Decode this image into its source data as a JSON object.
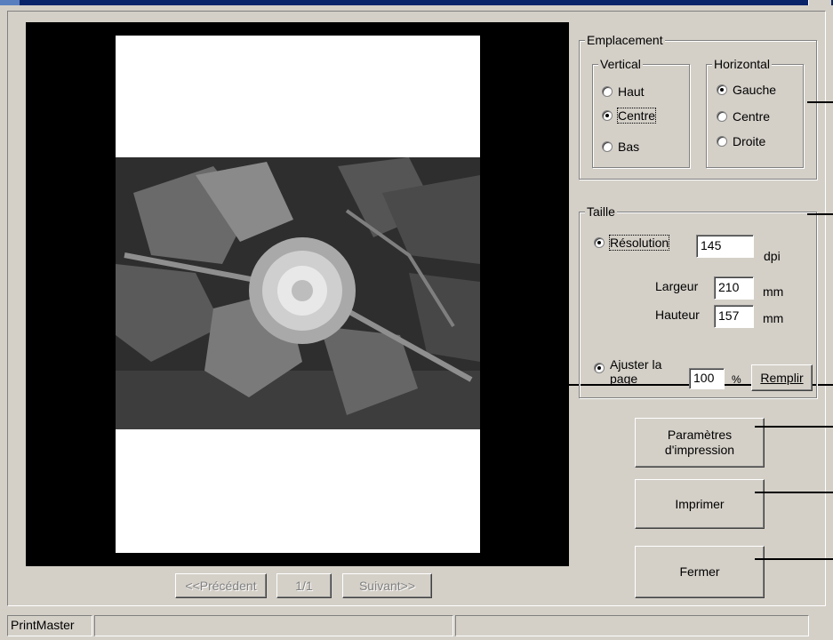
{
  "emplacement": {
    "legend": "Emplacement",
    "vertical": {
      "legend": "Vertical",
      "options": [
        "Haut",
        "Centre",
        "Bas"
      ],
      "selected": "Centre"
    },
    "horizontal": {
      "legend": "Horizontal",
      "options": [
        "Gauche",
        "Centre",
        "Droite"
      ],
      "selected": "Gauche"
    }
  },
  "taille": {
    "legend": "Taille",
    "resolution_label": "Résolution",
    "resolution_value": "145",
    "resolution_unit": "dpi",
    "largeur_label": "Largeur",
    "largeur_value": "210",
    "largeur_unit": "mm",
    "hauteur_label": "Hauteur",
    "hauteur_value": "157",
    "hauteur_unit": "mm",
    "ajuster_label": "Ajuster la page",
    "ajuster_value": "100",
    "ajuster_unit": "%",
    "remplir_label": "Remplir"
  },
  "buttons": {
    "parametres": "Paramètres\nd'impression",
    "imprimer": "Imprimer",
    "fermer": "Fermer"
  },
  "navigation": {
    "previous": "<<Précédent",
    "page": "1/1",
    "next": "Suivant>>"
  },
  "statusbar": {
    "app_name": "PrintMaster",
    "pane2": "",
    "pane3": ""
  },
  "colors": {
    "face": "#d4d0c8",
    "preview_bg": "#000000",
    "page_bg": "#ffffff"
  }
}
